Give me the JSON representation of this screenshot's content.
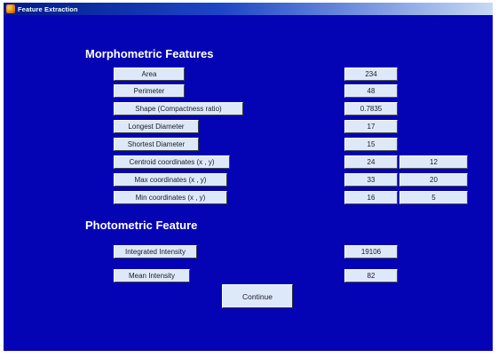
{
  "window": {
    "title": "Feature Extraction"
  },
  "morphometric": {
    "heading": "Morphometric Features",
    "rows": [
      {
        "label": "Area",
        "value": "234"
      },
      {
        "label": "Perimeter",
        "value": "48"
      },
      {
        "label": "Shape (Compactness ratio)",
        "value": "0.7835"
      },
      {
        "label": "Longest Diameter",
        "value": "17"
      },
      {
        "label": "Shortest Diameter",
        "value": "15"
      },
      {
        "label": "Centroid coordinates (x , y)",
        "x": "24",
        "y": "12"
      },
      {
        "label": "Max coordinates (x , y)",
        "x": "33",
        "y": "20"
      },
      {
        "label": "Min coordinates (x , y)",
        "x": "16",
        "y": "5"
      }
    ]
  },
  "photometric": {
    "heading": "Photometric Feature",
    "rows": [
      {
        "label": "Integrated Intensity",
        "value": "19106"
      },
      {
        "label": "Mean Intensity",
        "value": "82"
      }
    ]
  },
  "actions": {
    "continue_label": "Continue"
  },
  "colors": {
    "background": "#0504b4",
    "control": "#dde9f8",
    "heading_text": "#ffffff"
  }
}
